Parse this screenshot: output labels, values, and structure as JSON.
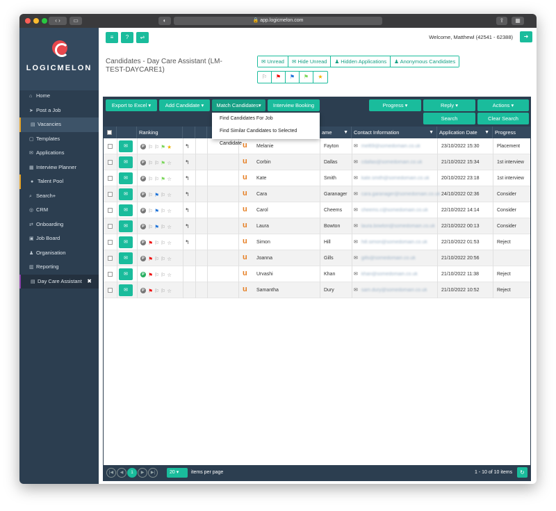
{
  "browser": {
    "url": "app.logicmelon.com"
  },
  "brand": {
    "name": "LOGICMELON",
    "accent": "#1abc9c",
    "sidebar_bg": "#2c3e50"
  },
  "topbar": {
    "welcome": "Welcome, Matthewl (42541 - 62388)"
  },
  "sidebar": {
    "items": [
      {
        "label": "Home",
        "icon": "home-icon",
        "glyph": "⌂"
      },
      {
        "label": "Post a Job",
        "icon": "send-icon",
        "glyph": "➤"
      },
      {
        "label": "Vacancies",
        "icon": "vacancies-icon",
        "glyph": "▤"
      },
      {
        "label": "Templates",
        "icon": "templates-icon",
        "glyph": "▢"
      },
      {
        "label": "Applications",
        "icon": "applications-icon",
        "glyph": "✉"
      },
      {
        "label": "Interview Planner",
        "icon": "calendar-icon",
        "glyph": "▦"
      },
      {
        "label": "Talent Pool",
        "icon": "user-icon",
        "glyph": "●"
      },
      {
        "label": "Search+",
        "icon": "search-icon",
        "glyph": "⌕"
      },
      {
        "label": "CRM",
        "icon": "crm-icon",
        "glyph": "◎"
      },
      {
        "label": "Onboarding",
        "icon": "onboarding-icon",
        "glyph": "⇄"
      },
      {
        "label": "Job Board",
        "icon": "job-board-icon",
        "glyph": "▣"
      },
      {
        "label": "Organisation",
        "icon": "organisation-icon",
        "glyph": "♟"
      },
      {
        "label": "Reporting",
        "icon": "reporting-icon",
        "glyph": "▥"
      },
      {
        "label": "Day Care Assistant",
        "icon": "vacancy-icon",
        "glyph": "▤"
      }
    ]
  },
  "page": {
    "title": "Candidates - Day Care Assistant (LM-TEST-DAYCARE1)",
    "filters": [
      "Unread",
      "Hide Unread",
      "Hidden Applications",
      "Anonymous Candidates"
    ]
  },
  "toolbar": {
    "export": "Export to Excel ▾",
    "add": "Add Candidate ▾",
    "match": "Match Candidates▾",
    "interview": "Interview Booking",
    "progress": "Progress ▾",
    "reply": "Reply ▾",
    "actions": "Actions ▾",
    "search": "Search",
    "clear": "Clear Search"
  },
  "match_menu": [
    "Find Candidates For Job",
    "Find Similar Candidates to Selected Candidate"
  ],
  "columns": {
    "ranking": "Ranking",
    "lastname": "ame",
    "contact": "Contact Information",
    "date": "Application Date",
    "progress": "Progress"
  },
  "rows": [
    {
      "first": "Melanie",
      "last": "Fayton",
      "email": "mel69@somedomain.co.uk",
      "date": "23/10/2022 15:30",
      "progress": "Placement",
      "p_green": false,
      "flags": [
        "white",
        "white",
        "green"
      ],
      "star": true,
      "reply": true
    },
    {
      "first": "Corbin",
      "last": "Dallas",
      "email": "cdallas@somedomain.co.uk",
      "date": "21/10/2022 15:34",
      "progress": "1st interview",
      "p_green": false,
      "flags": [
        "white",
        "white",
        "green"
      ],
      "star": false,
      "reply": true
    },
    {
      "first": "Kate",
      "last": "Smith",
      "email": "kate.smith@somedomain.co.uk",
      "date": "20/10/2022 23:18",
      "progress": "1st interview",
      "p_green": false,
      "flags": [
        "white",
        "white",
        "green"
      ],
      "star": false,
      "reply": true
    },
    {
      "first": "Cara",
      "last": "Garanager",
      "email": "cara.garanager@somedomain.co.uk",
      "date": "24/10/2022 02:36",
      "progress": "Consider",
      "p_green": false,
      "flags": [
        "white",
        "blue",
        "white"
      ],
      "star": false,
      "reply": true
    },
    {
      "first": "Carol",
      "last": "Cheems",
      "email": "cheems.c@somedomain.co.uk",
      "date": "22/10/2022 14:14",
      "progress": "Consider",
      "p_green": false,
      "flags": [
        "white",
        "blue",
        "white"
      ],
      "star": false,
      "reply": true
    },
    {
      "first": "Laura",
      "last": "Bowton",
      "email": "laura.bowton@somedomain.co.uk",
      "date": "22/10/2022 00:13",
      "progress": "Consider",
      "p_green": false,
      "flags": [
        "white",
        "blue",
        "white"
      ],
      "star": false,
      "reply": true
    },
    {
      "first": "Simon",
      "last": "Hill",
      "email": "hill.simon@somedomain.co.uk",
      "date": "22/10/2022 01:53",
      "progress": "Reject",
      "p_green": false,
      "flags": [
        "red",
        "white",
        "white"
      ],
      "star": false,
      "reply": true
    },
    {
      "first": "Joanna",
      "last": "Gills",
      "email": "gills@somedomain.co.uk",
      "date": "21/10/2022 20:56",
      "progress": "",
      "p_green": false,
      "flags": [
        "red",
        "white",
        "white"
      ],
      "star": false,
      "reply": false
    },
    {
      "first": "Urvashi",
      "last": "Khan",
      "email": "khan@somedomain.co.uk",
      "date": "21/10/2022 11:38",
      "progress": "Reject",
      "p_green": true,
      "flags": [
        "red",
        "white",
        "white"
      ],
      "star": false,
      "reply": false
    },
    {
      "first": "Samantha",
      "last": "Dury",
      "email": "sam.dury@somedomain.co.uk",
      "date": "21/10/2022 10:52",
      "progress": "Reject",
      "p_green": false,
      "flags": [
        "red",
        "white",
        "white"
      ],
      "star": false,
      "reply": false
    }
  ],
  "pager": {
    "current": "1",
    "page_size": "20",
    "items_per_page": "items per page",
    "summary": "1 - 10 of 10 items"
  }
}
